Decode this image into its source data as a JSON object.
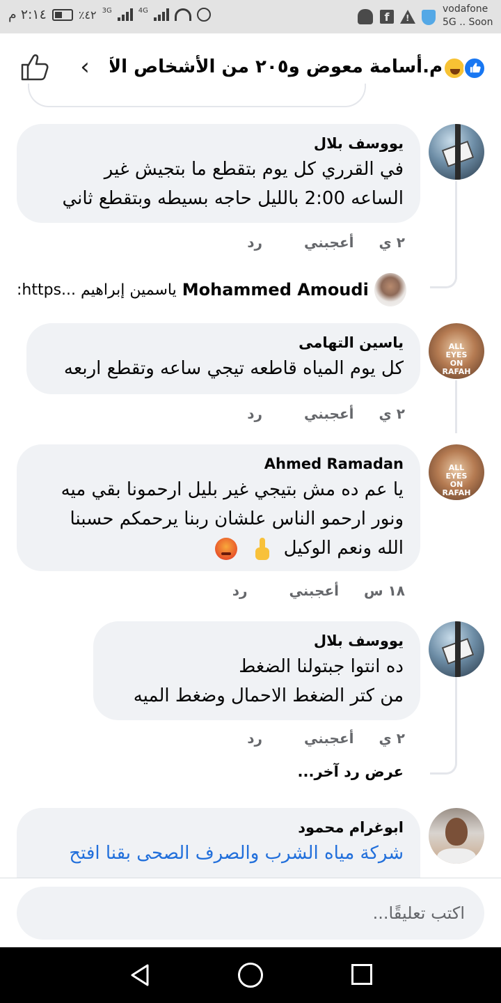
{
  "status_bar": {
    "time": "٢:١٤ م",
    "battery": "٪٤٢",
    "network_a": "3G",
    "network_b": "4G",
    "carrier_line1": "vodafone",
    "carrier_line2": "5G .. Soon"
  },
  "header": {
    "title": "م.أسامة معوض و٢٠٥ من الأشخاص الآ..."
  },
  "comments": [
    {
      "author": "يووسف بلال",
      "lines": [
        "في القرري كل يوم بتقطع ما بتجيش غير",
        "الساعه 2:00 بالليل حاجه بسيطه وبتقطع ثاني"
      ],
      "time": "٢ ي",
      "like": "أعجبني",
      "reply": "رد"
    },
    {
      "author": "ياسين التهامى",
      "lines": [
        "كل يوم المياه قاطعه تيجي ساعه وتقطع اربعه"
      ],
      "time": "٢ ي",
      "like": "أعجبني",
      "reply": "رد"
    },
    {
      "author": "Ahmed Ramadan",
      "lines": [
        "يا عم ده مش بتيجي غير بليل ارحمونا بقي ميه",
        "ونور ارحمو الناس علشان ربنا يرحمكم حسبنا",
        "الله ونعم الوكيل"
      ],
      "time": "١٨ س",
      "like": "أعجبني",
      "reply": "رد"
    },
    {
      "author": "يووسف بلال",
      "lines": [
        "ده انتوا  جبتولنا الضغط",
        "من كتر الضغط الاحمال وضغط الميه"
      ],
      "time": "٢ ي",
      "like": "أعجبني",
      "reply": "رد"
    },
    {
      "author": "ابوغرام محمود",
      "lines": [
        "شركة مياه الشرب والصرف الصحى بقنا افتح"
      ]
    }
  ],
  "reply_preview": {
    "author": "Mohammed Amoudi",
    "text": "ياسمين إبراهيم ...https:"
  },
  "more_replies": "عرض رد آخر...",
  "avatar_badge": {
    "line1": "ALL",
    "line2": "EYES",
    "line3": "ON",
    "line4": "RAFAH"
  },
  "composer": {
    "placeholder": "اكتب تعليقًا..."
  },
  "colors": {
    "bubble": "#f0f2f5",
    "link": "#216fdb",
    "muted": "#65676b",
    "accent": "#1877f2"
  },
  "icons": [
    "like-icon",
    "back-chevron-icon",
    "like-reaction-icon",
    "haha-reaction-icon",
    "angry-emoji-icon",
    "pointing-up-emoji-icon"
  ]
}
